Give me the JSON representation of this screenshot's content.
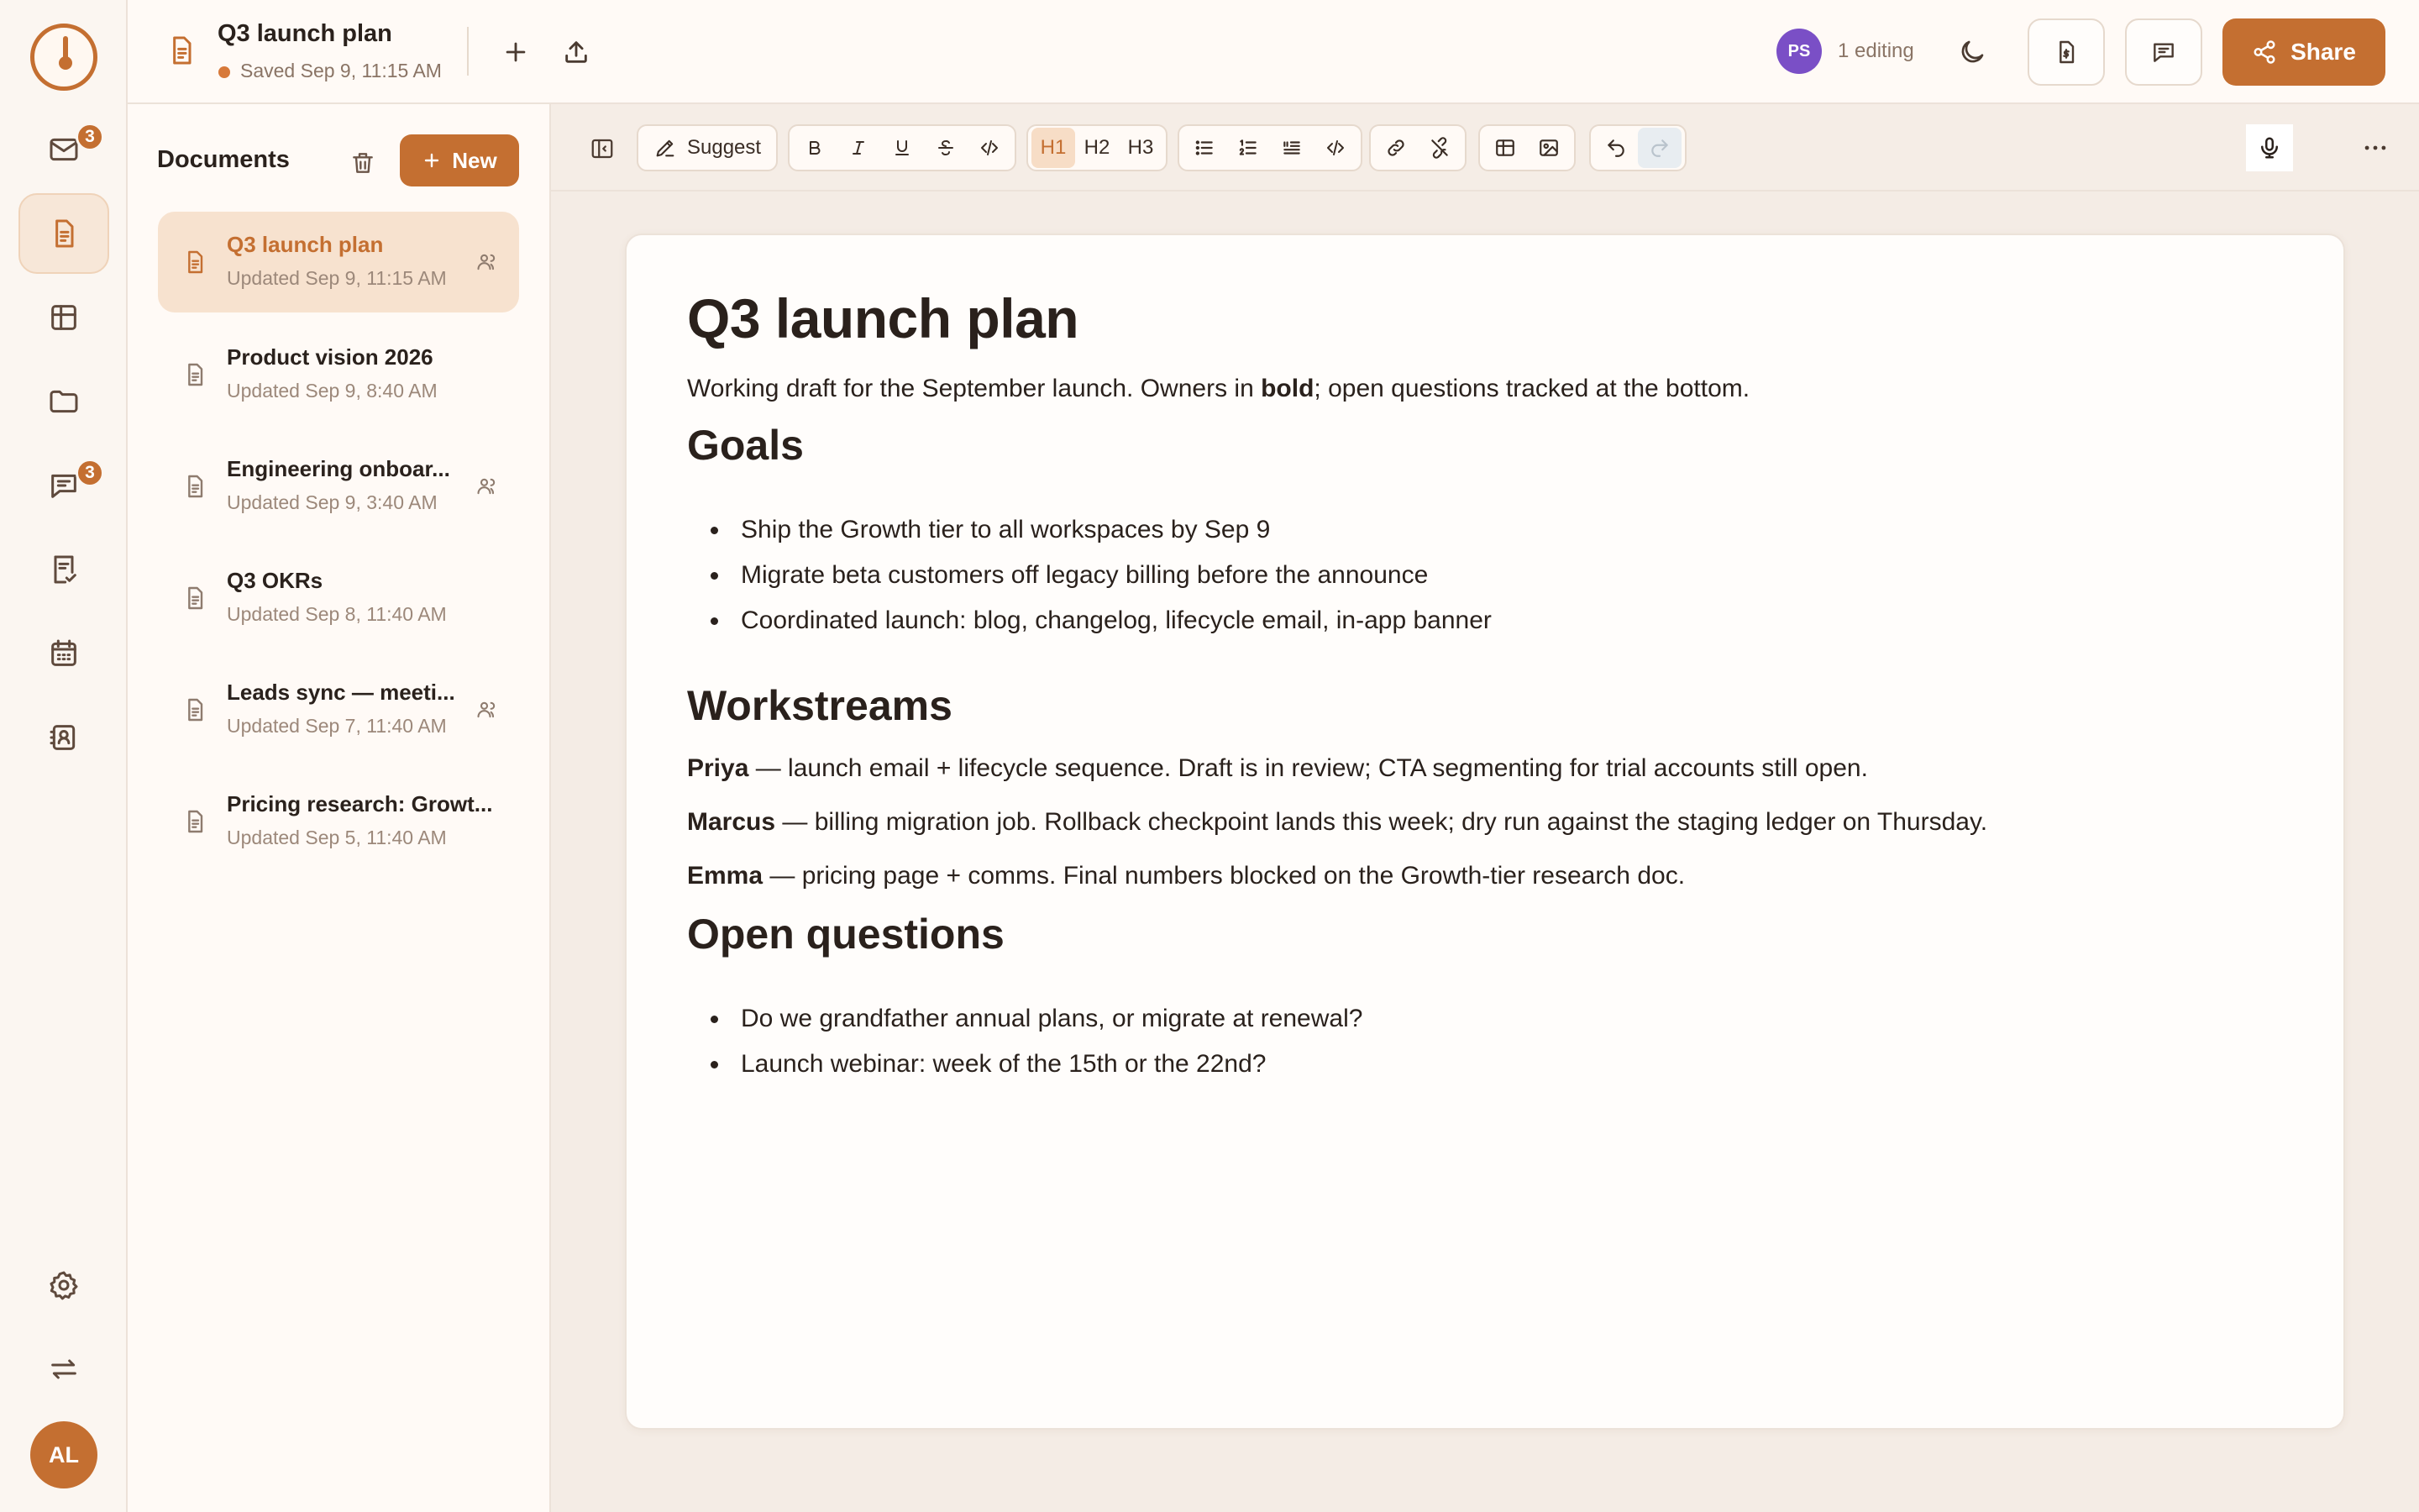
{
  "rail": {
    "items": [
      {
        "name": "mail",
        "badge": "3"
      },
      {
        "name": "documents",
        "badge": ""
      },
      {
        "name": "tables",
        "badge": ""
      },
      {
        "name": "files",
        "badge": ""
      },
      {
        "name": "chat",
        "badge": "3"
      },
      {
        "name": "tasks",
        "badge": ""
      },
      {
        "name": "calendar",
        "badge": ""
      },
      {
        "name": "contacts",
        "badge": ""
      }
    ],
    "user_initials": "AL"
  },
  "header": {
    "doc_title": "Q3 launch plan",
    "saved_status": "Saved Sep 9, 11:15 AM",
    "presence_initials": "PS",
    "editing_label": "1 editing",
    "share_label": "Share"
  },
  "docs": {
    "heading": "Documents",
    "new_label": "New",
    "items": [
      {
        "title": "Q3 launch plan",
        "updated": "Updated Sep 9, 11:15 AM",
        "shared": true,
        "active": true
      },
      {
        "title": "Product vision 2026",
        "updated": "Updated Sep 9, 8:40 AM",
        "shared": false,
        "active": false
      },
      {
        "title": "Engineering onboar...",
        "updated": "Updated Sep 9, 3:40 AM",
        "shared": true,
        "active": false
      },
      {
        "title": "Q3 OKRs",
        "updated": "Updated Sep 8, 11:40 AM",
        "shared": false,
        "active": false
      },
      {
        "title": "Leads sync — meeti...",
        "updated": "Updated Sep 7, 11:40 AM",
        "shared": true,
        "active": false
      },
      {
        "title": "Pricing research: Growt...",
        "updated": "Updated Sep 5, 11:40 AM",
        "shared": false,
        "active": false
      }
    ]
  },
  "toolbar": {
    "suggest_label": "Suggest",
    "h1": "H1",
    "h2": "H2",
    "h3": "H3"
  },
  "document": {
    "title": "Q3 launch plan",
    "intro_before": "Working draft for the September launch. Owners in ",
    "intro_bold": "bold",
    "intro_after": "; open questions tracked at the bottom.",
    "goals_heading": "Goals",
    "goals": [
      "Ship the Growth tier to all workspaces by Sep 9",
      "Migrate beta customers off legacy billing before the announce",
      "Coordinated launch: blog, changelog, lifecycle email, in-app banner"
    ],
    "workstreams_heading": "Workstreams",
    "workstreams": [
      {
        "owner": "Priya",
        "text": " — launch email + lifecycle sequence. Draft is in review; CTA segmenting for trial accounts still open."
      },
      {
        "owner": "Marcus",
        "text": " — billing migration job. Rollback checkpoint lands this week; dry run against the staging ledger on Thursday."
      },
      {
        "owner": "Emma",
        "text": " — pricing page + comms. Final numbers blocked on the Growth-tier research doc."
      }
    ],
    "questions_heading": "Open questions",
    "questions": [
      "Do we grandfather annual plans, or migrate at renewal?",
      "Launch webinar: week of the 15th or the 22nd?"
    ]
  },
  "colors": {
    "accent": "#c46f31",
    "presence": "#7a4fc6",
    "background": "#f4ece5",
    "panel": "#fffaf6"
  }
}
